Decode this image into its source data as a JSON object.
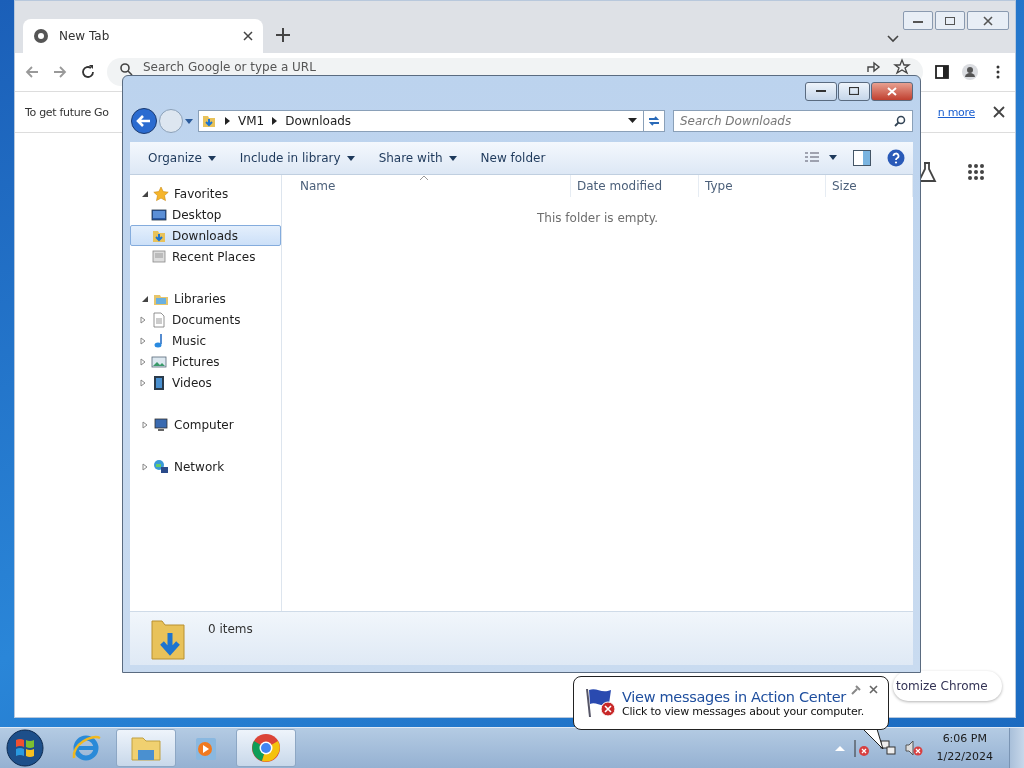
{
  "chrome_window": {
    "tabs": [
      {
        "title": "New Tab",
        "selected": true
      }
    ],
    "omnibox": {
      "placeholder": "Search Google or type a URL"
    },
    "info_bar": {
      "text": "To get future Go",
      "link": "n more"
    },
    "customize_button": "tomize Chrome"
  },
  "explorer_window": {
    "breadcrumb": [
      "VM1",
      "Downloads"
    ],
    "search": {
      "placeholder": "Search Downloads"
    },
    "toolbar": [
      {
        "label": "Organize",
        "dropdown": true
      },
      {
        "label": "Include in library",
        "dropdown": true
      },
      {
        "label": "Share with",
        "dropdown": true
      },
      {
        "label": "New folder",
        "dropdown": false
      }
    ],
    "nav_tree": [
      {
        "label": "Favorites",
        "kind": "star",
        "expanded": true,
        "children": [
          {
            "label": "Desktop",
            "kind": "desktop",
            "selected": false
          },
          {
            "label": "Downloads",
            "kind": "download",
            "selected": true
          },
          {
            "label": "Recent Places",
            "kind": "recent",
            "selected": false
          }
        ]
      },
      {
        "label": "Libraries",
        "kind": "library",
        "expanded": true,
        "children": [
          {
            "label": "Documents",
            "kind": "document",
            "expanded": false
          },
          {
            "label": "Music",
            "kind": "music",
            "expanded": false
          },
          {
            "label": "Pictures",
            "kind": "picture",
            "expanded": false
          },
          {
            "label": "Videos",
            "kind": "video",
            "expanded": false
          }
        ]
      },
      {
        "label": "Computer",
        "kind": "computer",
        "expanded": false
      },
      {
        "label": "Network",
        "kind": "network",
        "expanded": false
      }
    ],
    "columns": [
      "Name",
      "Date modified",
      "Type",
      "Size"
    ],
    "empty_message": "This folder is empty.",
    "status": "0 items"
  },
  "notification": {
    "title": "View messages in Action Center",
    "body": "Click to view messages about your computer."
  },
  "taskbar": {
    "apps": [
      {
        "kind": "ie",
        "running": false
      },
      {
        "kind": "explorer",
        "running": true
      },
      {
        "kind": "media",
        "running": false
      },
      {
        "kind": "chrome",
        "running": true
      }
    ],
    "clock": {
      "time": "6:06 PM",
      "date": "1/22/2024"
    }
  }
}
